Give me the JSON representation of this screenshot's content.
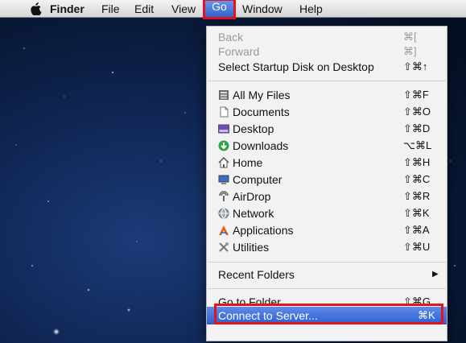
{
  "menubar": {
    "apple": "apple-icon",
    "items": [
      "Finder",
      "File",
      "Edit",
      "View",
      "Go",
      "Window",
      "Help"
    ]
  },
  "menu": {
    "back": {
      "label": "Back",
      "shortcut": "⌘["
    },
    "forward": {
      "label": "Forward",
      "shortcut": "⌘]"
    },
    "startup": {
      "label": "Select Startup Disk on Desktop",
      "shortcut": "⇧⌘↑"
    },
    "places": [
      {
        "label": "All My Files",
        "shortcut": "⇧⌘F",
        "icon": "all-my-files-icon"
      },
      {
        "label": "Documents",
        "shortcut": "⇧⌘O",
        "icon": "documents-icon"
      },
      {
        "label": "Desktop",
        "shortcut": "⇧⌘D",
        "icon": "desktop-icon"
      },
      {
        "label": "Downloads",
        "shortcut": "⌥⌘L",
        "icon": "downloads-icon"
      },
      {
        "label": "Home",
        "shortcut": "⇧⌘H",
        "icon": "home-icon"
      },
      {
        "label": "Computer",
        "shortcut": "⇧⌘C",
        "icon": "computer-icon"
      },
      {
        "label": "AirDrop",
        "shortcut": "⇧⌘R",
        "icon": "airdrop-icon"
      },
      {
        "label": "Network",
        "shortcut": "⇧⌘K",
        "icon": "network-icon"
      },
      {
        "label": "Applications",
        "shortcut": "⇧⌘A",
        "icon": "applications-icon"
      },
      {
        "label": "Utilities",
        "shortcut": "⇧⌘U",
        "icon": "utilities-icon"
      }
    ],
    "recent": {
      "label": "Recent Folders",
      "arrow": "▶"
    },
    "goto": {
      "label": "Go to Folder...",
      "shortcut": "⇧⌘G"
    },
    "connect": {
      "label": "Connect to Server...",
      "shortcut": "⌘K"
    }
  },
  "colors": {
    "highlight": "#2f64d6",
    "annotation": "#e3131b"
  }
}
